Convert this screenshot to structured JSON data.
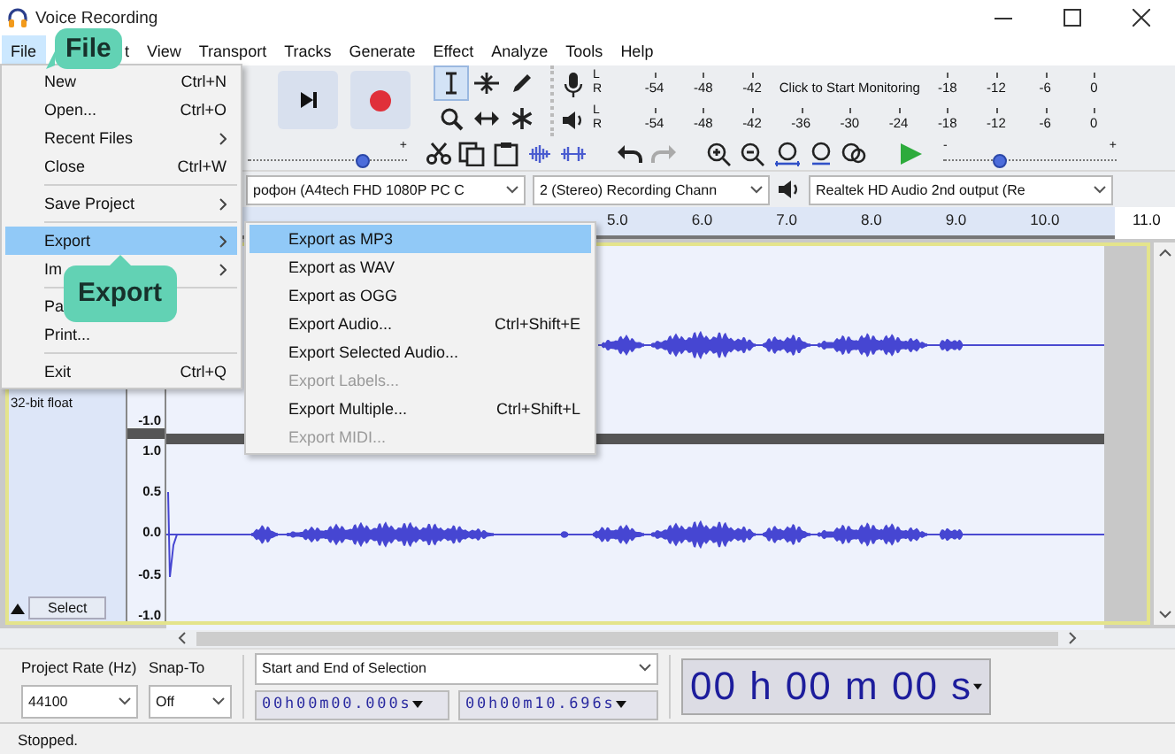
{
  "window": {
    "title": "Voice Recording"
  },
  "menu_bar": [
    {
      "label": "File",
      "selected": true
    },
    {
      "label": "t",
      "selected": false
    },
    {
      "label": "View",
      "selected": false
    },
    {
      "label": "Transport",
      "selected": false
    },
    {
      "label": "Tracks",
      "selected": false
    },
    {
      "label": "Generate",
      "selected": false
    },
    {
      "label": "Effect",
      "selected": false
    },
    {
      "label": "Analyze",
      "selected": false
    },
    {
      "label": "Tools",
      "selected": false
    },
    {
      "label": "Help",
      "selected": false
    }
  ],
  "file_menu": [
    {
      "label": "New",
      "shortcut": "Ctrl+N",
      "submenu": false,
      "selected": false,
      "divider_after": false
    },
    {
      "label": "Open...",
      "shortcut": "Ctrl+O",
      "submenu": false,
      "selected": false,
      "divider_after": false
    },
    {
      "label": "Recent Files",
      "submenu": true,
      "selected": false,
      "divider_after": false
    },
    {
      "label": "Close",
      "shortcut": "Ctrl+W",
      "submenu": false,
      "selected": false,
      "divider_after": true
    },
    {
      "label": "Save Project",
      "submenu": true,
      "selected": false,
      "divider_after": true
    },
    {
      "label": "Export",
      "submenu": true,
      "selected": true,
      "divider_after": false
    },
    {
      "label": "Im",
      "submenu": true,
      "selected": false,
      "divider_after": true
    },
    {
      "label": "Pa",
      "submenu": false,
      "selected": false,
      "divider_after": false
    },
    {
      "label": "Print...",
      "submenu": false,
      "selected": false,
      "divider_after": true
    },
    {
      "label": "Exit",
      "shortcut": "Ctrl+Q",
      "submenu": false,
      "selected": false,
      "divider_after": false
    }
  ],
  "export_submenu": [
    {
      "label": "Export as MP3",
      "selected": true,
      "disabled": false
    },
    {
      "label": "Export as WAV",
      "selected": false,
      "disabled": false
    },
    {
      "label": "Export as OGG",
      "selected": false,
      "disabled": false
    },
    {
      "label": "Export Audio...",
      "shortcut": "Ctrl+Shift+E",
      "selected": false,
      "disabled": false
    },
    {
      "label": "Export Selected Audio...",
      "selected": false,
      "disabled": false
    },
    {
      "label": "Export Labels...",
      "selected": false,
      "disabled": true
    },
    {
      "label": "Export Multiple...",
      "shortcut": "Ctrl+Shift+L",
      "selected": false,
      "disabled": false
    },
    {
      "label": "Export MIDI...",
      "selected": false,
      "disabled": true
    }
  ],
  "callouts": [
    {
      "text": "File"
    },
    {
      "text": "Export"
    }
  ],
  "tools": [
    {
      "kind": "selection",
      "selected": true
    },
    {
      "kind": "envelope",
      "selected": false
    },
    {
      "kind": "draw",
      "selected": false
    },
    {
      "kind": "zoom",
      "selected": false
    },
    {
      "kind": "time-shift",
      "selected": false
    },
    {
      "kind": "multi",
      "selected": false
    }
  ],
  "meters": [
    {
      "kind": "recording",
      "channels": [
        "L",
        "R"
      ],
      "ticks": [
        "-54",
        "-48",
        "-42"
      ],
      "prompt": "Click to Start Monitoring",
      "ticks_after": [
        "-18",
        "-12",
        "-6",
        "0"
      ]
    },
    {
      "kind": "playback",
      "channels": [
        "L",
        "R"
      ],
      "ticks": [
        "-54",
        "-48",
        "-42",
        "-36",
        "-30",
        "-24",
        "-18",
        "-12",
        "-6",
        "0"
      ]
    }
  ],
  "recording_volume": {
    "max_label": "+",
    "level": 0.72
  },
  "playback_speed": {
    "min_label": "-",
    "max_label": "+",
    "level": 0.33
  },
  "devices": {
    "recording_device": "рофон (A4tech FHD 1080P PC C",
    "recording_channels": "2 (Stereo) Recording Chann",
    "playback_device": "Realtek HD Audio 2nd output (Re"
  },
  "ruler": {
    "labels": [
      "5.0",
      "6.0",
      "7.0",
      "8.0",
      "9.0",
      "10.0"
    ],
    "end_label": "11.0"
  },
  "track": {
    "format": "32-bit float",
    "select_button": "Select",
    "channel_scales": [
      [
        "-1.0"
      ],
      [
        "1.0",
        "0.5",
        "0.0",
        "-0.5",
        "-1.0"
      ]
    ]
  },
  "selection_toolbar": {
    "project_rate_label": "Project Rate (Hz)",
    "project_rate": "44100",
    "snap_label": "Snap-To",
    "snap": "Off",
    "selection_mode": "Start and End of Selection",
    "start": "00h00m00.000s",
    "end": "00h00m10.696s",
    "time": "00 h 00 m 00 s"
  },
  "status_bar": {
    "text": "Stopped."
  }
}
